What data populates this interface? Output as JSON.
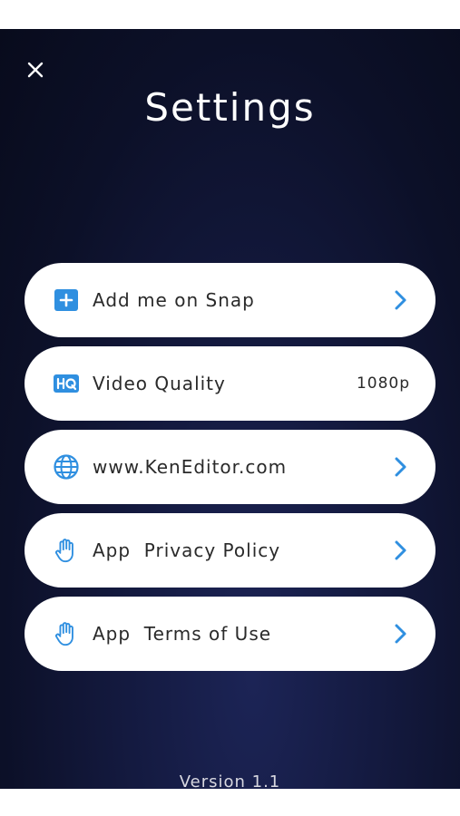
{
  "header": {
    "close_icon": "close-icon",
    "title": "Settings"
  },
  "menu": {
    "items": [
      {
        "id": "add-me-on-snap",
        "icon": "plus-square-icon",
        "label": "Add me on Snap",
        "value": "",
        "trailing": "chevron-right-icon"
      },
      {
        "id": "video-quality",
        "icon": "hq-badge-icon",
        "label": "Video Quality",
        "value": "1080p",
        "trailing": ""
      },
      {
        "id": "website",
        "icon": "globe-icon",
        "label": "www.KenEditor.com",
        "value": "",
        "trailing": "chevron-right-icon"
      },
      {
        "id": "privacy-policy",
        "icon": "hand-icon",
        "label": "App  Privacy Policy",
        "value": "",
        "trailing": "chevron-right-icon"
      },
      {
        "id": "terms-of-use",
        "icon": "hand-icon",
        "label": "App  Terms of Use",
        "value": "",
        "trailing": "chevron-right-icon"
      }
    ]
  },
  "footer": {
    "version": "Version 1.1"
  },
  "colors": {
    "accent": "#2f8fe0",
    "background": "#0c1028",
    "card": "#ffffff",
    "text": "#2a2a2a"
  }
}
